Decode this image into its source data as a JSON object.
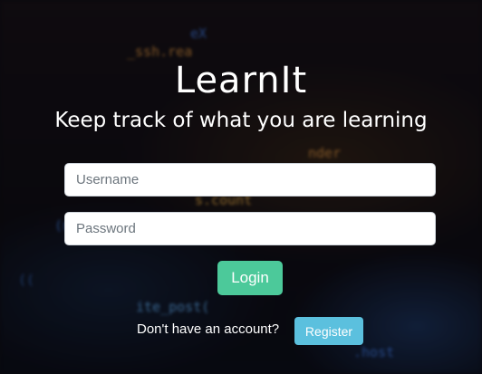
{
  "app": {
    "title": "LearnIt",
    "subtitle": "Keep track of what you are learning"
  },
  "form": {
    "username": {
      "value": "",
      "placeholder": "Username"
    },
    "password": {
      "value": "",
      "placeholder": "Password"
    },
    "login_label": "Login"
  },
  "footer": {
    "prompt": "Don't have an account?",
    "register_label": "Register"
  },
  "colors": {
    "login_button": "#4cc99a",
    "register_button": "#5bc0de",
    "text": "#ffffff"
  }
}
